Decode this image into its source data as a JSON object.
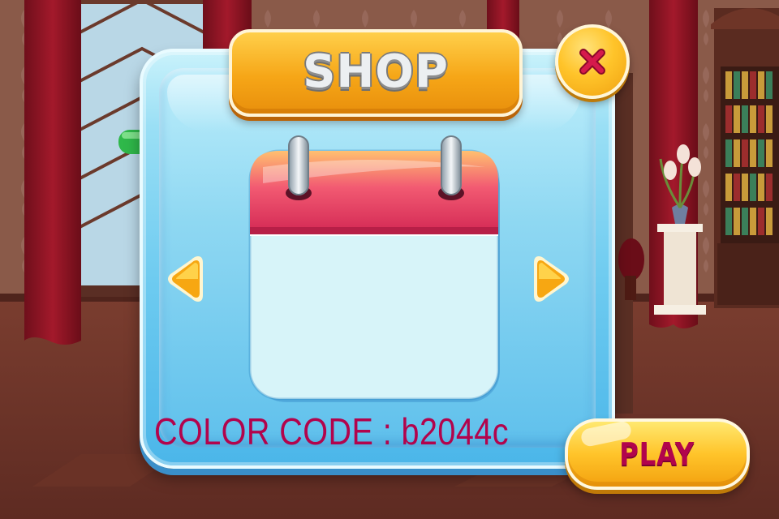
{
  "shop": {
    "title": "SHOP",
    "color_code_label": "COLOR CODE : b2044c"
  },
  "buttons": {
    "play_label": "PLAY"
  },
  "icons": {
    "close": "close-icon",
    "prev": "left-arrow-icon",
    "next": "right-arrow-icon",
    "item": "calendar-icon"
  },
  "colors": {
    "accent": "#b2044c",
    "panel": "#6ecbf0",
    "button": "#ffc42a",
    "calendar_header": "#e43a63"
  }
}
